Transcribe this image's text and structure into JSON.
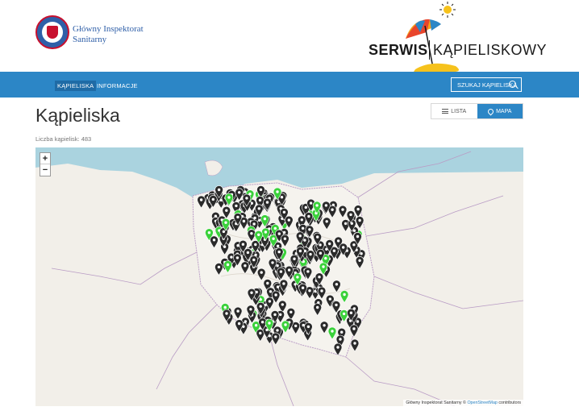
{
  "header": {
    "gis_name": "Główny Inspektorat Sanitarny",
    "serwis_bold": "SERWIS",
    "serwis_light": "KĄPIELISKOWY"
  },
  "nav": {
    "items": [
      {
        "label": "KĄPIELISKA",
        "active": true
      },
      {
        "label": "INFORMACJE",
        "active": false
      }
    ],
    "search_label": "SZUKAJ KĄPIELISKA"
  },
  "page": {
    "title": "Kąpieliska",
    "count_text": "Liczba kąpielisk: 483"
  },
  "view_toggle": {
    "lista": "LISTA",
    "mapa": "MAPA"
  },
  "map": {
    "zoom_in": "+",
    "zoom_out": "−",
    "attribution_prefix": "Główny Inspektorat Sanitarny © ",
    "attribution_link": "OpenStreetMap",
    "attribution_suffix": " contributors",
    "colors": {
      "marker_default": "#2a2a2a",
      "marker_green": "#3ad13a",
      "sea": "#aad3df",
      "land": "#f2efe9"
    }
  }
}
